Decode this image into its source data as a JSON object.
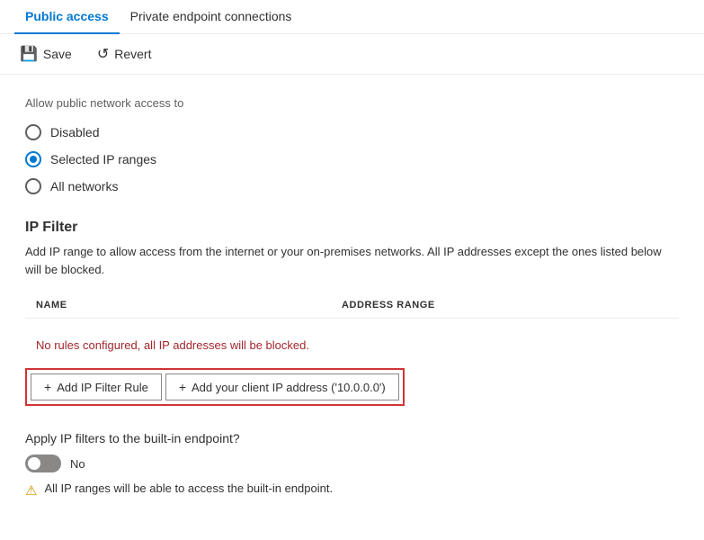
{
  "tabs": [
    {
      "id": "public-access",
      "label": "Public access",
      "active": true
    },
    {
      "id": "private-endpoint",
      "label": "Private endpoint connections",
      "active": false
    }
  ],
  "toolbar": {
    "save_label": "Save",
    "revert_label": "Revert"
  },
  "content": {
    "allow_label": "Allow public network access to",
    "radio_options": [
      {
        "id": "disabled",
        "label": "Disabled",
        "selected": false
      },
      {
        "id": "selected-ip",
        "label": "Selected IP ranges",
        "selected": true
      },
      {
        "id": "all-networks",
        "label": "All networks",
        "selected": false
      }
    ],
    "ip_filter": {
      "title": "IP Filter",
      "description": "Add IP range to allow access from the internet or your on-premises networks. All IP addresses except the ones listed below will be blocked.",
      "table": {
        "columns": [
          {
            "id": "name",
            "label": "NAME"
          },
          {
            "id": "address-range",
            "label": "ADDRESS RANGE"
          }
        ]
      },
      "no_rules_message": "No rules configured, all IP addresses will be blocked.",
      "add_filter_rule_label": "Add IP Filter Rule",
      "add_client_ip_label": "Add your client IP address ('10.0.0.0')"
    },
    "apply_filters": {
      "label": "Apply IP filters to the built-in endpoint?",
      "toggle_value": false,
      "toggle_text": "No",
      "warning": "All IP ranges will be able to access the built-in endpoint."
    }
  }
}
